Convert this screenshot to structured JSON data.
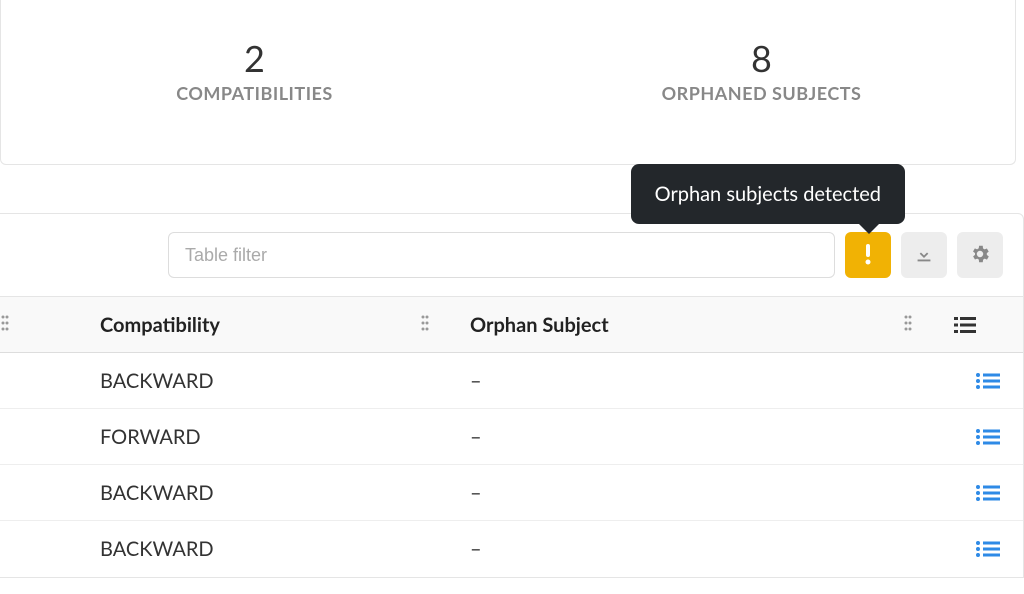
{
  "summary": {
    "compatibilities": {
      "value": "2",
      "label": "COMPATIBILITIES"
    },
    "orphaned": {
      "value": "8",
      "label": "ORPHANED SUBJECTS"
    }
  },
  "tooltip": "Orphan subjects detected",
  "filter": {
    "placeholder": "Table filter",
    "value": ""
  },
  "columns": {
    "compatibility": "Compatibility",
    "orphan": "Orphan Subject"
  },
  "rows": [
    {
      "compatibility": "BACKWARD",
      "orphan": "–"
    },
    {
      "compatibility": "FORWARD",
      "orphan": "–"
    },
    {
      "compatibility": "BACKWARD",
      "orphan": "–"
    },
    {
      "compatibility": "BACKWARD",
      "orphan": "–"
    }
  ],
  "colors": {
    "warn": "#f1b204",
    "accent": "#2e8ae6",
    "muted": "#888888"
  }
}
